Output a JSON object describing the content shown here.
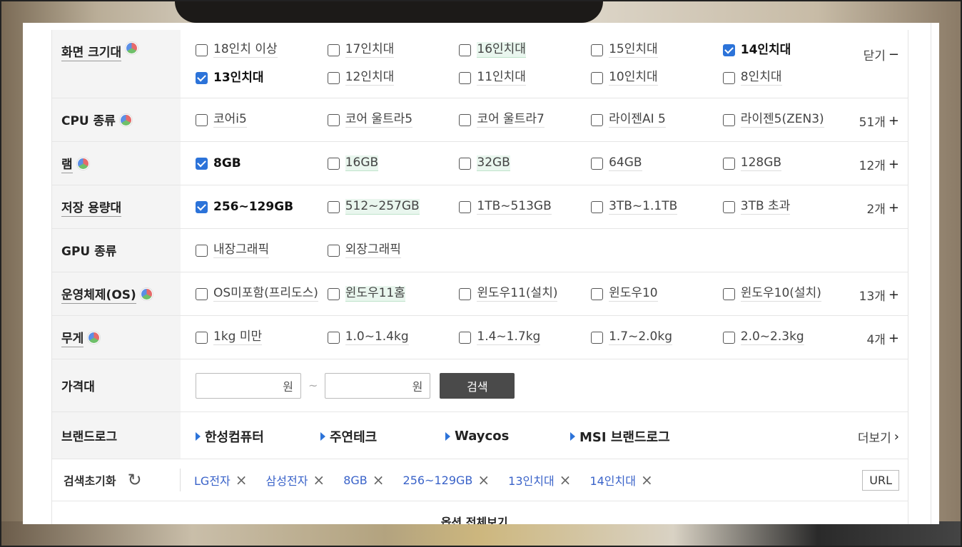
{
  "rows": [
    {
      "label": "화면 크기대",
      "pie": true,
      "more": "닫기",
      "more_sym": "−",
      "options": [
        {
          "text": "18인치 이상",
          "checked": false,
          "style": ""
        },
        {
          "text": "17인치대",
          "checked": false,
          "style": ""
        },
        {
          "text": "16인치대",
          "checked": false,
          "style": "hl"
        },
        {
          "text": "15인치대",
          "checked": false,
          "style": ""
        },
        {
          "text": "14인치대",
          "checked": true,
          "style": "sel"
        },
        {
          "text": "13인치대",
          "checked": true,
          "style": "sel"
        },
        {
          "text": "12인치대",
          "checked": false,
          "style": ""
        },
        {
          "text": "11인치대",
          "checked": false,
          "style": ""
        },
        {
          "text": "10인치대",
          "checked": false,
          "style": ""
        },
        {
          "text": "8인치대",
          "checked": false,
          "style": ""
        }
      ]
    },
    {
      "label": "CPU 종류",
      "pie": true,
      "more": "51개",
      "more_sym": "+",
      "options": [
        {
          "text": "코어i5",
          "checked": false,
          "style": ""
        },
        {
          "text": "코어 울트라5",
          "checked": false,
          "style": ""
        },
        {
          "text": "코어 울트라7",
          "checked": false,
          "style": ""
        },
        {
          "text": "라이젠AI 5",
          "checked": false,
          "style": ""
        },
        {
          "text": "라이젠5(ZEN3)",
          "checked": false,
          "style": ""
        }
      ]
    },
    {
      "label": "램",
      "pie": true,
      "more": "12개",
      "more_sym": "+",
      "options": [
        {
          "text": "8GB",
          "checked": true,
          "style": "sel"
        },
        {
          "text": "16GB",
          "checked": false,
          "style": "hl"
        },
        {
          "text": "32GB",
          "checked": false,
          "style": "hl"
        },
        {
          "text": "64GB",
          "checked": false,
          "style": ""
        },
        {
          "text": "128GB",
          "checked": false,
          "style": ""
        }
      ]
    },
    {
      "label": "저장 용량대",
      "pie": false,
      "more": "2개",
      "more_sym": "+",
      "options": [
        {
          "text": "256~129GB",
          "checked": true,
          "style": "sel"
        },
        {
          "text": "512~257GB",
          "checked": false,
          "style": "hl"
        },
        {
          "text": "1TB~513GB",
          "checked": false,
          "style": ""
        },
        {
          "text": "3TB~1.1TB",
          "checked": false,
          "style": ""
        },
        {
          "text": "3TB 초과",
          "checked": false,
          "style": ""
        }
      ]
    },
    {
      "label": "GPU 종류",
      "pie": false,
      "more": "",
      "more_sym": "",
      "options": [
        {
          "text": "내장그래픽",
          "checked": false,
          "style": ""
        },
        {
          "text": "외장그래픽",
          "checked": false,
          "style": ""
        }
      ]
    },
    {
      "label": "운영체제(OS)",
      "pie": true,
      "more": "13개",
      "more_sym": "+",
      "options": [
        {
          "text": "OS미포함(프리도스)",
          "checked": false,
          "style": "ellip"
        },
        {
          "text": "윈도우11홈",
          "checked": false,
          "style": "hl"
        },
        {
          "text": "윈도우11(설치)",
          "checked": false,
          "style": ""
        },
        {
          "text": "윈도우10",
          "checked": false,
          "style": ""
        },
        {
          "text": "윈도우10(설치)",
          "checked": false,
          "style": ""
        }
      ]
    },
    {
      "label": "무게",
      "pie": true,
      "more": "4개",
      "more_sym": "+",
      "options": [
        {
          "text": "1kg 미만",
          "checked": false,
          "style": ""
        },
        {
          "text": "1.0~1.4kg",
          "checked": false,
          "style": ""
        },
        {
          "text": "1.4~1.7kg",
          "checked": false,
          "style": ""
        },
        {
          "text": "1.7~2.0kg",
          "checked": false,
          "style": ""
        },
        {
          "text": "2.0~2.3kg",
          "checked": false,
          "style": ""
        }
      ]
    }
  ],
  "price": {
    "label": "가격대",
    "unit": "원",
    "tilde": "~",
    "search": "검색"
  },
  "brand": {
    "label": "브랜드로그",
    "items": [
      "한성컴퓨터",
      "주연테크",
      "Waycos",
      "MSI 브랜드로그"
    ],
    "more": "더보기",
    "more_sym": "›"
  },
  "reset": {
    "label": "검색초기화",
    "chips": [
      "LG전자",
      "삼성전자",
      "8GB",
      "256~129GB",
      "13인치대",
      "14인치대"
    ],
    "url": "URL"
  },
  "all_options": {
    "label": "옵션 전체보기",
    "chevron": "⌄"
  },
  "icons": {
    "refresh": "refresh-icon",
    "remove": "close-icon",
    "pie": "pie-chart-icon"
  }
}
